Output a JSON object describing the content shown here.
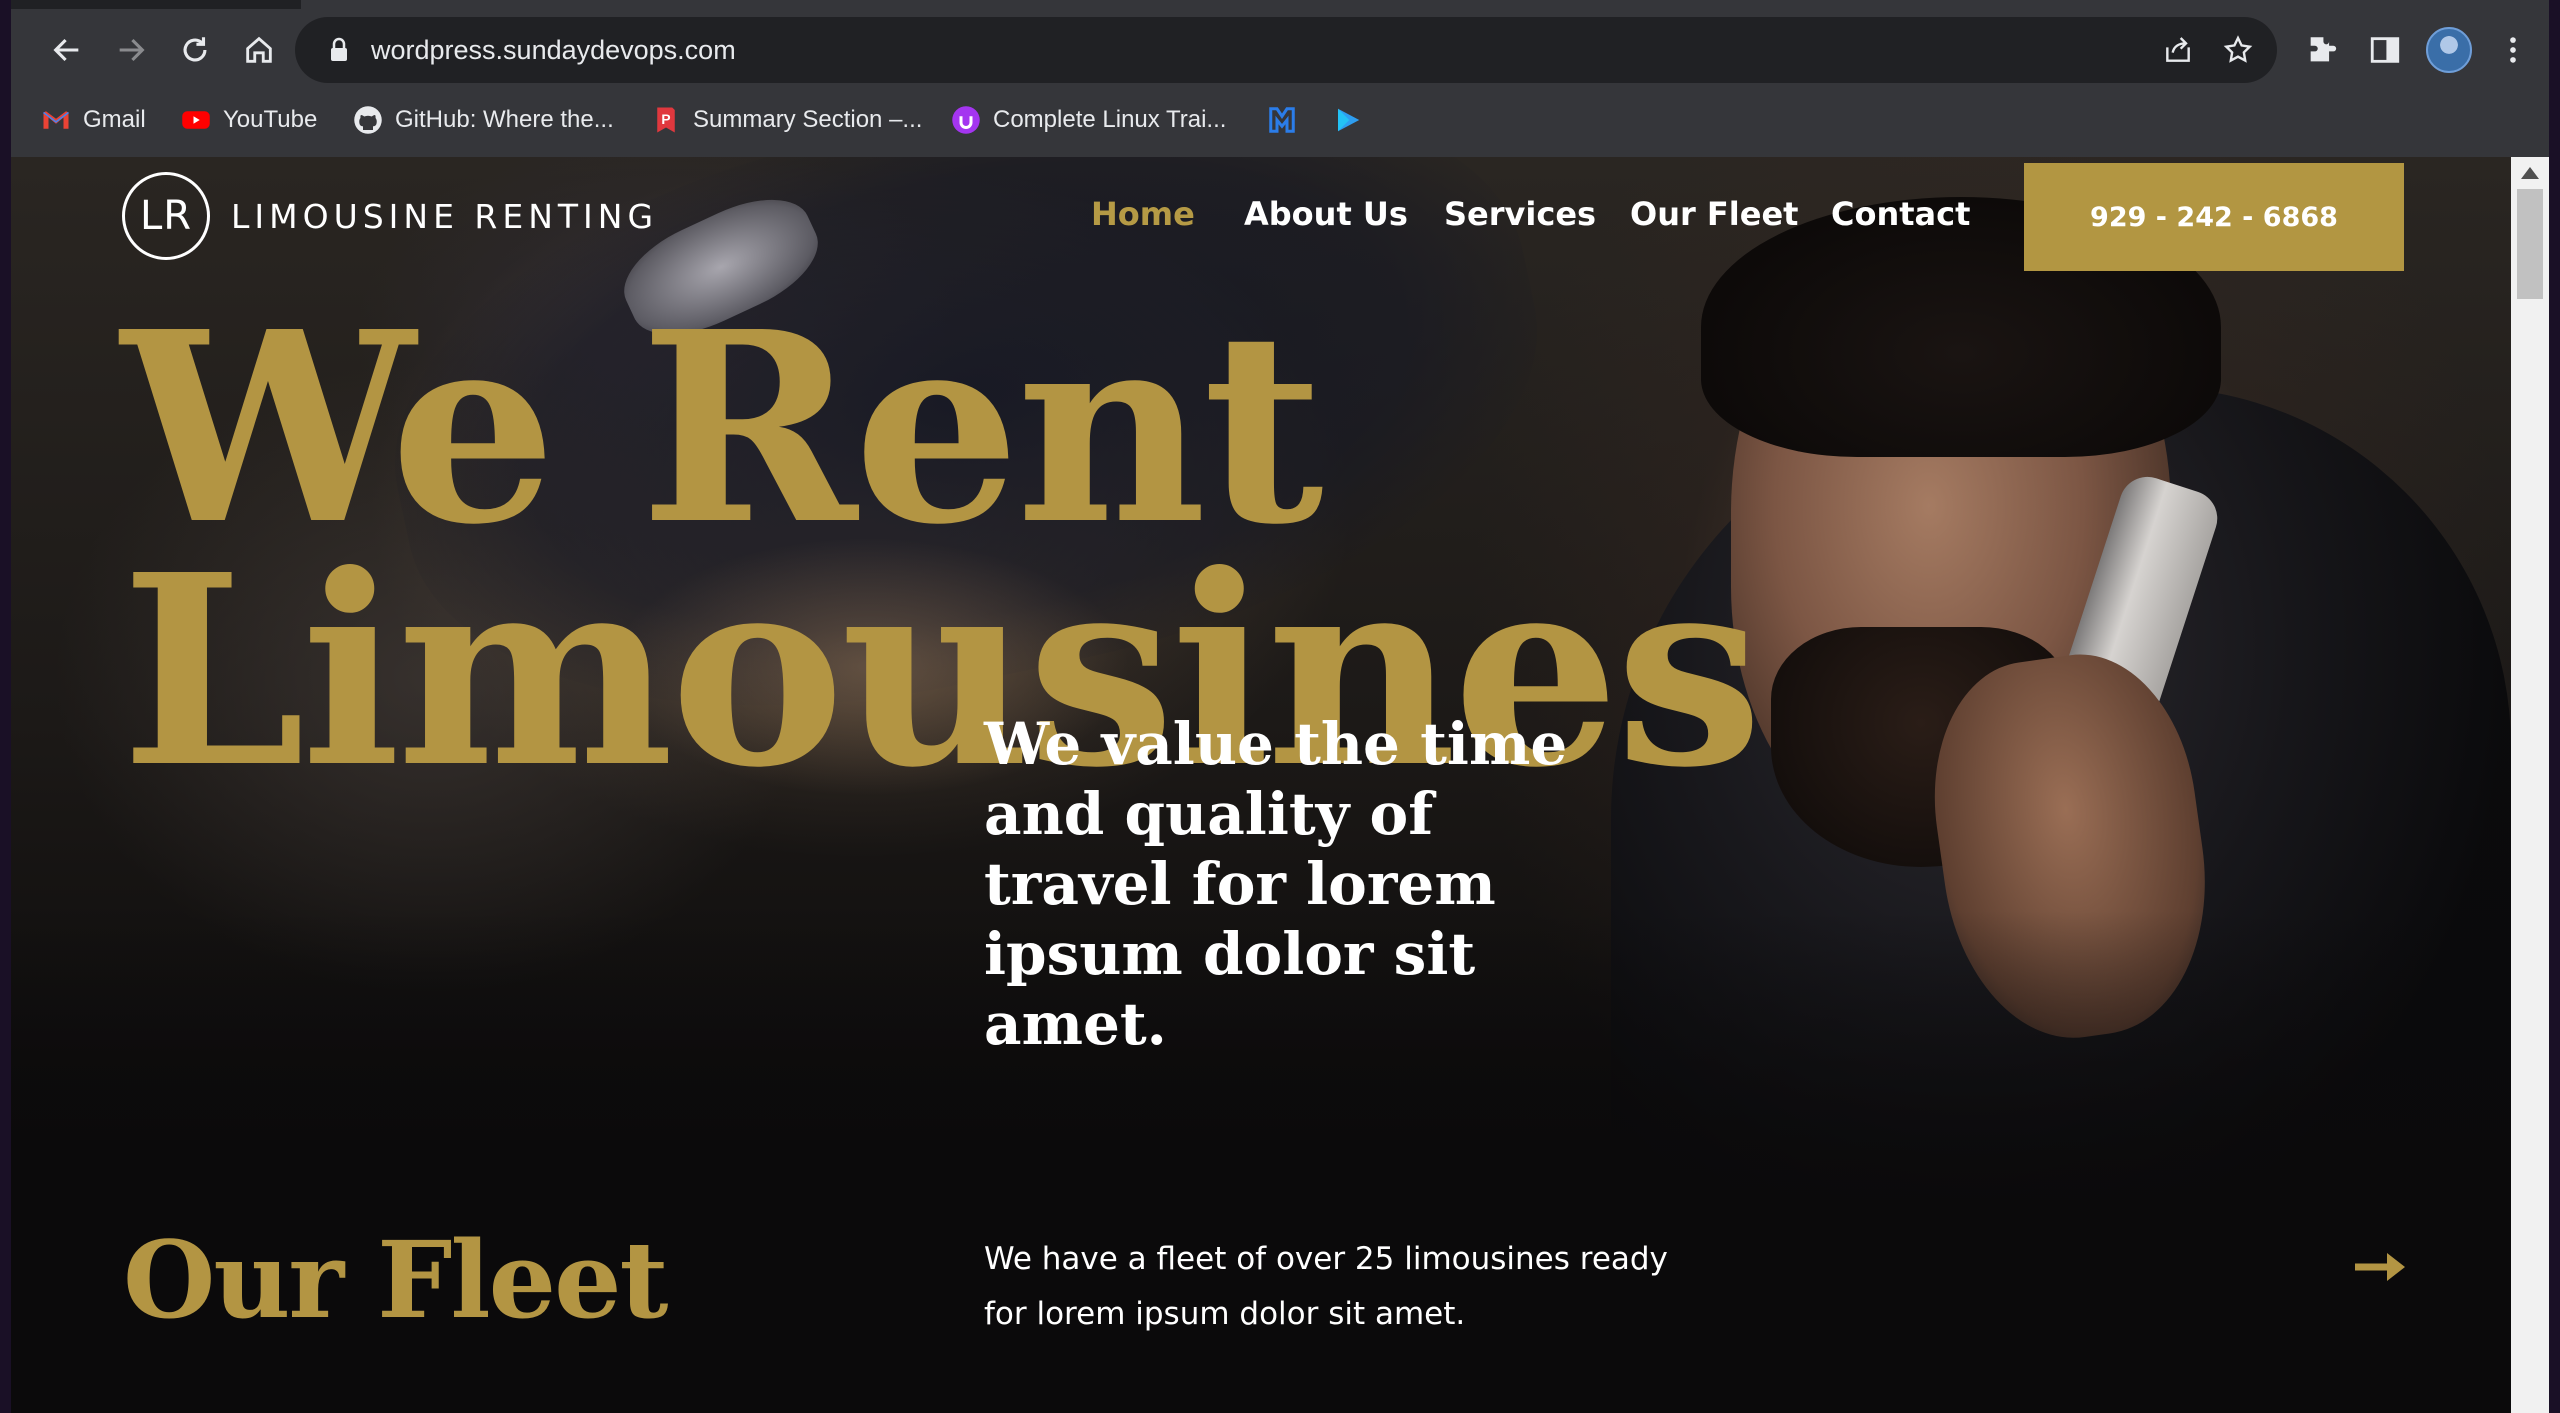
{
  "browser": {
    "url": "wordpress.sundaydevops.com",
    "bookmarks": [
      {
        "label": "Gmail",
        "icon": "gmail-icon"
      },
      {
        "label": "YouTube",
        "icon": "youtube-icon"
      },
      {
        "label": "GitHub: Where the...",
        "icon": "github-icon"
      },
      {
        "label": "Summary Section –...",
        "icon": "p-icon"
      },
      {
        "label": "Complete Linux Trai...",
        "icon": "udemy-icon"
      },
      {
        "label": "",
        "icon": "m-logo-icon"
      },
      {
        "label": "",
        "icon": "play-icon"
      }
    ]
  },
  "site": {
    "logo_mark": "LR",
    "logo_text": "LIMOUSINE RENTING",
    "nav": [
      {
        "label": "Home",
        "active": true
      },
      {
        "label": "About Us",
        "active": false
      },
      {
        "label": "Services",
        "active": false
      },
      {
        "label": "Our Fleet",
        "active": false
      },
      {
        "label": "Contact",
        "active": false
      }
    ],
    "phone": "929 - 242 - 6868",
    "accent_color": "#b39543"
  },
  "hero": {
    "headline_line1": "We Rent",
    "headline_line2": "Limousines",
    "tagline": "We value the time and quality of travel for lorem ipsum dolor sit amet."
  },
  "fleet": {
    "title": "Our Fleet",
    "description": "We have a fleet of over 25 limousines ready for lorem ipsum dolor sit amet.",
    "arrow_icon": "arrow-right-icon"
  }
}
